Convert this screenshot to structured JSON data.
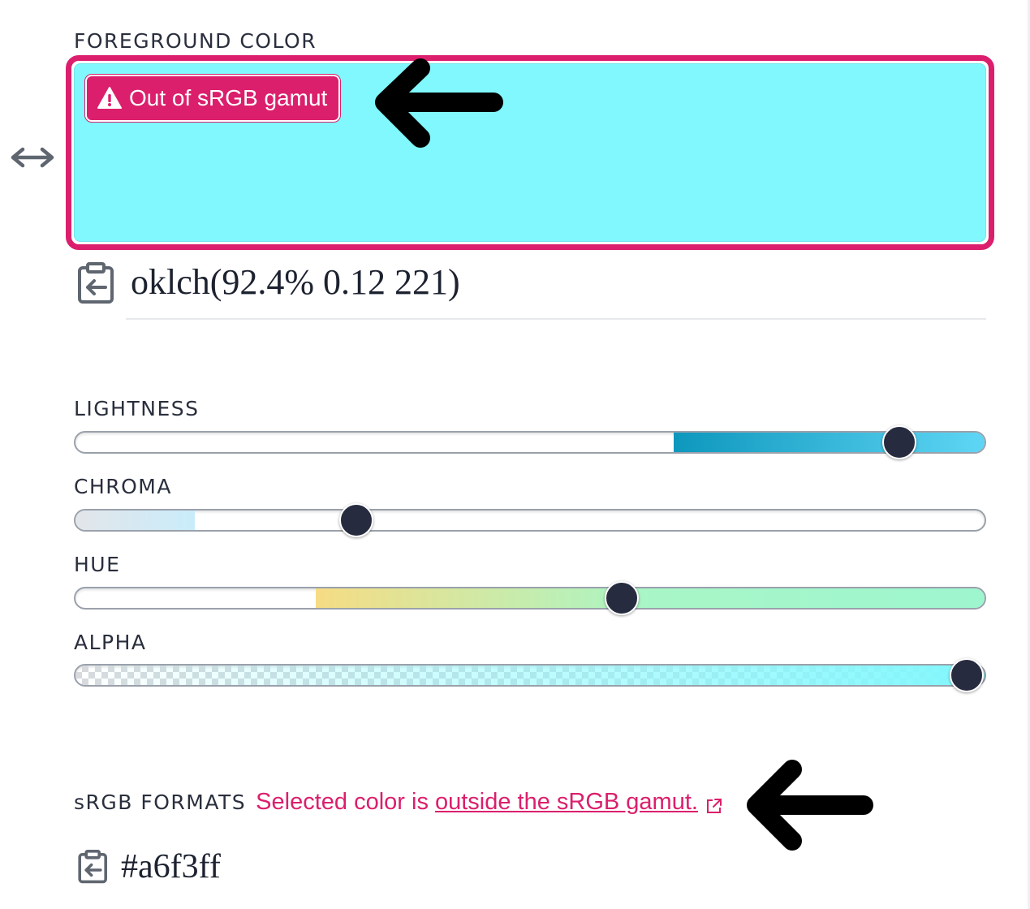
{
  "foreground": {
    "label": "FOREGROUND COLOR",
    "swatch_color": "#80f8fd",
    "badge_text": "Out of sRGB gamut",
    "value": "oklch(92.4% 0.12 221)"
  },
  "sliders": {
    "lightness": {
      "label": "LIGHTNESS",
      "value_fraction": 0.924,
      "gradient": [
        "#0e97bd",
        "#5fd6f5"
      ]
    },
    "chroma": {
      "label": "CHROMA",
      "value_fraction": 0.31,
      "gradient": [
        "#e3e6ea",
        "#c9ecfa"
      ]
    },
    "hue": {
      "label": "HUE",
      "value_fraction": 0.61,
      "gradient": [
        "#f6dc84",
        "#a8f6c7",
        "#9ef6cf"
      ]
    },
    "alpha": {
      "label": "ALPHA",
      "value_fraction": 1.0,
      "gradient": [
        "#80f8fd"
      ]
    }
  },
  "formats": {
    "label": "sRGB FORMATS",
    "warning_text": "Selected color is",
    "warning_link": "outside the sRGB gamut.",
    "hex_value": "#a6f3ff"
  },
  "colors": {
    "accent": "#db1f6c",
    "thumb": "#262b40",
    "text": "#1f2433"
  },
  "icons": {
    "resize": "left-right-arrow-icon",
    "copy": "clipboard-copy-icon",
    "warning": "warning-triangle-icon",
    "external": "external-link-icon"
  }
}
